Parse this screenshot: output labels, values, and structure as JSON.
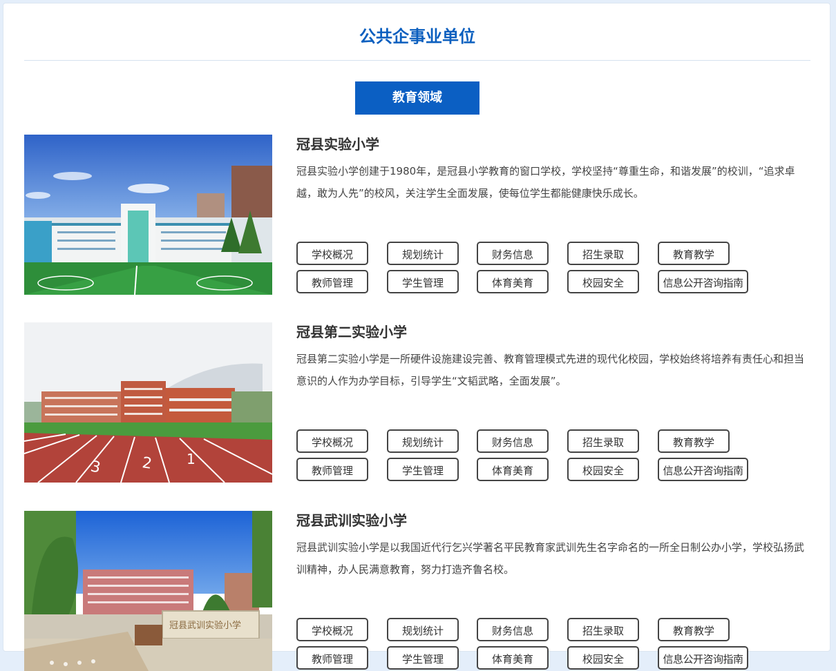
{
  "header": {
    "title": "公共企事业单位",
    "active_tab": "教育领域"
  },
  "schools": [
    {
      "name": "冠县实验小学",
      "description": "冠县实验小学创建于1980年，是冠县小学教育的窗口学校，学校坚持“尊重生命，和谐发展”的校训，“追求卓越，敢为人先”的校风，关注学生全面发展，使每位学生都能健康快乐成长。",
      "links": [
        "学校概况",
        "规划统计",
        "财务信息",
        "招生录取",
        "教育教学",
        "教师管理",
        "学生管理",
        "体育美育",
        "校园安全",
        "信息公开咨询指南"
      ]
    },
    {
      "name": "冠县第二实验小学",
      "description": "冠县第二实验小学是一所硬件设施建设完善、教育管理模式先进的现代化校园，学校始终将培养有责任心和担当意识的人作为办学目标，引导学生“文韬武略，全面发展”。",
      "links": [
        "学校概况",
        "规划统计",
        "财务信息",
        "招生录取",
        "教育教学",
        "教师管理",
        "学生管理",
        "体育美育",
        "校园安全",
        "信息公开咨询指南"
      ]
    },
    {
      "name": "冠县武训实验小学",
      "description": "冠县武训实验小学是以我国近代行乞兴学著名平民教育家武训先生名字命名的一所全日制公办小学，学校弘扬武训精神，办人民满意教育，努力打造齐鲁名校。",
      "links": [
        "学校概况",
        "规划统计",
        "财务信息",
        "招生录取",
        "教育教学",
        "教师管理",
        "学生管理",
        "体育美育",
        "校园安全",
        "信息公开咨询指南"
      ]
    }
  ],
  "colors": {
    "accent": "#0b5fc3",
    "title": "#0b5fbf",
    "page_background": "#e4eefa"
  }
}
